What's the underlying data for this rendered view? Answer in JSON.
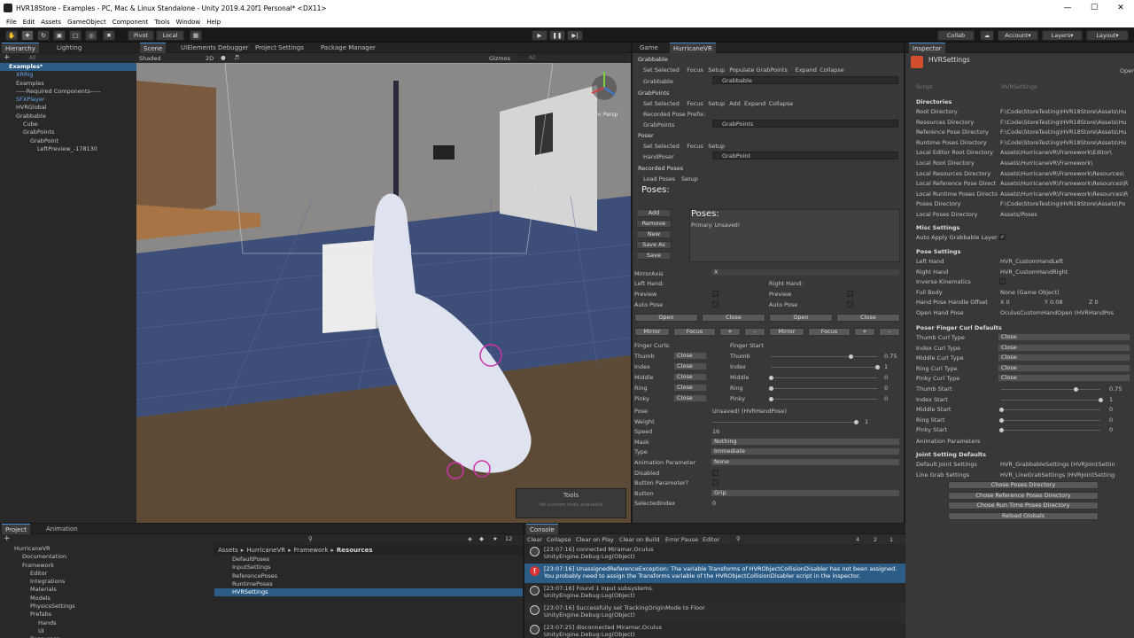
{
  "title": "HVR18Store - Examples - PC, Mac & Linux Standalone - Unity 2019.4.20f1 Personal* <DX11>",
  "menu": [
    "File",
    "Edit",
    "Assets",
    "GameObject",
    "Component",
    "Tools",
    "Window",
    "Help"
  ],
  "toolbar": {
    "pivot": "Pivot",
    "local": "Local",
    "collab": "Collab",
    "account": "Account",
    "layers": "Layers",
    "layout": "Layout"
  },
  "hierarchy": {
    "tab": "Hierarchy",
    "tab2": "Lighting",
    "search": "All",
    "items": [
      {
        "t": "Examples*",
        "d": 0,
        "c": "root"
      },
      {
        "t": "XRRig",
        "d": 1,
        "c": "blue"
      },
      {
        "t": "Examples",
        "d": 1,
        "c": ""
      },
      {
        "t": "-----Required Components-----",
        "d": 1,
        "c": ""
      },
      {
        "t": "SFXPlayer",
        "d": 1,
        "c": "blue"
      },
      {
        "t": "HVRGlobal",
        "d": 1,
        "c": ""
      },
      {
        "t": "Grabbable",
        "d": 1,
        "c": ""
      },
      {
        "t": "Cube",
        "d": 2,
        "c": ""
      },
      {
        "t": "GrabPoints",
        "d": 2,
        "c": ""
      },
      {
        "t": "GrabPoint",
        "d": 3,
        "c": ""
      },
      {
        "t": "LeftPreview_-178130",
        "d": 4,
        "c": ""
      }
    ]
  },
  "scene": {
    "tabs": [
      "Scene",
      "UIElements Debugger",
      "Project Settings",
      "Package Manager"
    ],
    "shaded": "Shaded",
    "mode2d": "2D",
    "gizmos": "Gizmos",
    "search": "All",
    "persp": "< Persp",
    "tools_title": "Tools",
    "tools_msg": "No custom tools available"
  },
  "game": {
    "tabs": [
      "Game",
      "HurricaneVR"
    ]
  },
  "grabbable": {
    "header": "Grabbable",
    "buttons": [
      "Set Selected",
      "Focus",
      "Setup",
      "Populate GrabPoints",
      "Expand",
      "Collapse"
    ],
    "field_label": "Grabbable",
    "field_value": "Grabbable",
    "gp_header": "GrabPoints",
    "gp_buttons": [
      "Set Selected",
      "Focus",
      "Setup",
      "Add",
      "Expand",
      "Collapse"
    ],
    "recorded_prefix": "Recorded Pose Prefix:",
    "gp_field": "GrabPoints",
    "gp_value": "GrabPoints",
    "poser_header": "Poser",
    "poser_buttons": [
      "Set Selected",
      "Focus",
      "Setup"
    ],
    "handposer_label": "HandPoser",
    "handposer_value": "GrabPoint",
    "recorded_header": "Recorded Poses",
    "load_poses": "Load Poses",
    "setup": "Setup",
    "poses_title": "Poses:"
  },
  "poses": {
    "buttons": [
      "Add",
      "Remove",
      "New",
      "Save As",
      "Save"
    ],
    "title": "Poses:",
    "item": "Primary: Unsaved!"
  },
  "hands": {
    "mirror_axis": "MirrorAxis",
    "mirror_value": "X",
    "left": "Left Hand:",
    "right": "Right Hand:",
    "preview": "Preview",
    "auto_pose": "Auto Pose",
    "open": "Open",
    "close": "Close",
    "mirror": "Mirror",
    "focus": "Focus",
    "plus": "+",
    "minus": "-"
  },
  "curls": {
    "title": "Finger Curls:",
    "start_title": "Finger Start",
    "fingers": [
      "Thumb",
      "Index",
      "Middle",
      "Ring",
      "Pinky"
    ],
    "curl_value": "Close",
    "start": [
      0.75,
      1,
      0,
      0,
      0
    ]
  },
  "props": {
    "rows": [
      {
        "l": "Pose",
        "v": "Unsaved! (HVRHandPose)"
      },
      {
        "l": "Weight",
        "v": "1"
      },
      {
        "l": "Speed",
        "v": "16"
      },
      {
        "l": "Mask",
        "v": "Nothing"
      },
      {
        "l": "Type",
        "v": "Immediate"
      },
      {
        "l": "Animation Parameter",
        "v": "None"
      },
      {
        "l": "Disabled",
        "v": ""
      },
      {
        "l": "Button Parameter?",
        "v": ""
      },
      {
        "l": "Button",
        "v": "Grip"
      },
      {
        "l": "SelectedIndex",
        "v": "0"
      }
    ]
  },
  "inspector": {
    "tab": "Inspector",
    "object": "HVRSettings",
    "open": "Open",
    "script_label": "Script",
    "script_value": "HVRSettings",
    "dir_header": "Directories",
    "dirs": [
      {
        "l": "Root Directory",
        "v": "F:\\Code\\StoreTesting\\HVR18Store\\Assets\\Hu"
      },
      {
        "l": "Resources Directory",
        "v": "F:\\Code\\StoreTesting\\HVR18Store\\Assets\\Hu"
      },
      {
        "l": "Reference Pose Directory",
        "v": "F:\\Code\\StoreTesting\\HVR18Store\\Assets\\Hu"
      },
      {
        "l": "Runtime Poses Directory",
        "v": "F:\\Code\\StoreTesting\\HVR18Store\\Assets\\Hu"
      },
      {
        "l": "Local Editor Root Directory",
        "v": "Assets\\HurricaneVR\\Framework\\Editor\\"
      },
      {
        "l": "Local Root Directory",
        "v": "Assets\\HurricaneVR\\Framework\\"
      },
      {
        "l": "Local Resources Directory",
        "v": "Assets\\HurricaneVR\\Framework\\Resources\\"
      },
      {
        "l": "Local Reference Pose Direct",
        "v": "Assets\\HurricaneVR\\Framework\\Resources\\R"
      },
      {
        "l": "Local Runtime Poses Directo",
        "v": "Assets\\HurricaneVR\\Framework\\Resources\\R"
      },
      {
        "l": "Poses Directory",
        "v": "F:\\Code\\StoreTesting\\HVR18Store\\Assets\\Po"
      },
      {
        "l": "Local Poses Directory",
        "v": "Assets/Poses"
      }
    ],
    "misc_header": "Misc Settings",
    "auto_apply": "Auto Apply Grabbable Layer",
    "pose_header": "Pose Settings",
    "pose": [
      {
        "l": "Left Hand",
        "v": "HVR_CustomHandLeft"
      },
      {
        "l": "Right Hand",
        "v": "HVR_CustomHandRight"
      },
      {
        "l": "Inverse Kinematics",
        "v": ""
      },
      {
        "l": "Full Body",
        "v": "None (Game Object)"
      },
      {
        "l": "Hand Pose Handle Offset",
        "v": ""
      },
      {
        "l": "Open Hand Pose",
        "v": "OculusCustomHandOpen (HVRHandPos"
      }
    ],
    "offset": {
      "x": "X 0",
      "y": "Y 0.08",
      "z": "Z 0"
    },
    "curl_header": "Poser Finger Curl Defaults",
    "curls": [
      {
        "l": "Thumb Curl Type",
        "v": "Close"
      },
      {
        "l": "Index Curl Type",
        "v": "Close"
      },
      {
        "l": "Middle Curl Type",
        "v": "Close"
      },
      {
        "l": "Ring Curl Type",
        "v": "Close"
      },
      {
        "l": "Pinky Curl Type",
        "v": "Close"
      }
    ],
    "starts": [
      {
        "l": "Thumb Start",
        "v": "0.75",
        "f": 0.75
      },
      {
        "l": "Index Start",
        "v": "1",
        "f": 1
      },
      {
        "l": "Middle Start",
        "v": "0",
        "f": 0
      },
      {
        "l": "Ring Start",
        "v": "0",
        "f": 0
      },
      {
        "l": "Pinky Start",
        "v": "0",
        "f": 0
      }
    ],
    "anim_params": "Animation Parameters",
    "joint_header": "Joint Setting Defaults",
    "joints": [
      {
        "l": "Default Joint Settings",
        "v": "HVR_GrabbableSettings (HVRJointSettin"
      },
      {
        "l": "Line Grab Settings",
        "v": "HVR_LineGrabSettings (HVRJointSetting"
      }
    ],
    "buttons": [
      "Chose Poses Directory",
      "Chose Reference Poses Directory",
      "Chose Run Time Poses Directory",
      "Reload Globals"
    ]
  },
  "project": {
    "tab": "Project",
    "tab2": "Animation",
    "tree": [
      {
        "t": "HurricaneVR",
        "d": 0
      },
      {
        "t": "Documentation",
        "d": 1
      },
      {
        "t": "Framework",
        "d": 1
      },
      {
        "t": "Editor",
        "d": 2
      },
      {
        "t": "Integrations",
        "d": 2
      },
      {
        "t": "Materials",
        "d": 2
      },
      {
        "t": "Models",
        "d": 2
      },
      {
        "t": "PhysicsSettings",
        "d": 2
      },
      {
        "t": "Prefabs",
        "d": 2
      },
      {
        "t": "Hands",
        "d": 3
      },
      {
        "t": "UI",
        "d": 3
      },
      {
        "t": "Resources",
        "d": 2
      }
    ],
    "breadcrumb": [
      "Assets",
      "HurricaneVR",
      "Framework",
      "Resources"
    ],
    "files": [
      "DefaultPoses",
      "InputSettings",
      "ReferencePoses",
      "RuntimePoses",
      "HVRSettings"
    ],
    "count": "12"
  },
  "console": {
    "tab": "Console",
    "buttons": [
      "Clear",
      "Collapse",
      "Clear on Play",
      "Clear on Build",
      "Error Pause",
      "Editor"
    ],
    "warn_count": "2",
    "info_count": "4",
    "err_count": "1",
    "logs": [
      {
        "k": "info",
        "a": "[23:07:16] connected Miramar,Oculus",
        "b": "UnityEngine.Debug:Log(Object)"
      },
      {
        "k": "err",
        "a": "[23:07:16] UnassignedReferenceException: The variable Transforms of HVRObjectCollisionDisabler has not been assigned.",
        "b": "You probably need to assign the Transforms variable of the HVRObjectCollisionDisabler script in the inspector."
      },
      {
        "k": "info",
        "a": "[23:07:16] Found 1 input subsystems.",
        "b": "UnityEngine.Debug:Log(Object)"
      },
      {
        "k": "info",
        "a": "[23:07:16] Successfully set TrackingOriginMode to Floor",
        "b": "UnityEngine.Debug:Log(Object)"
      },
      {
        "k": "info",
        "a": "[23:07:25] disconnected Miramar,Oculus",
        "b": "UnityEngine.Debug:Log(Object)"
      }
    ]
  }
}
